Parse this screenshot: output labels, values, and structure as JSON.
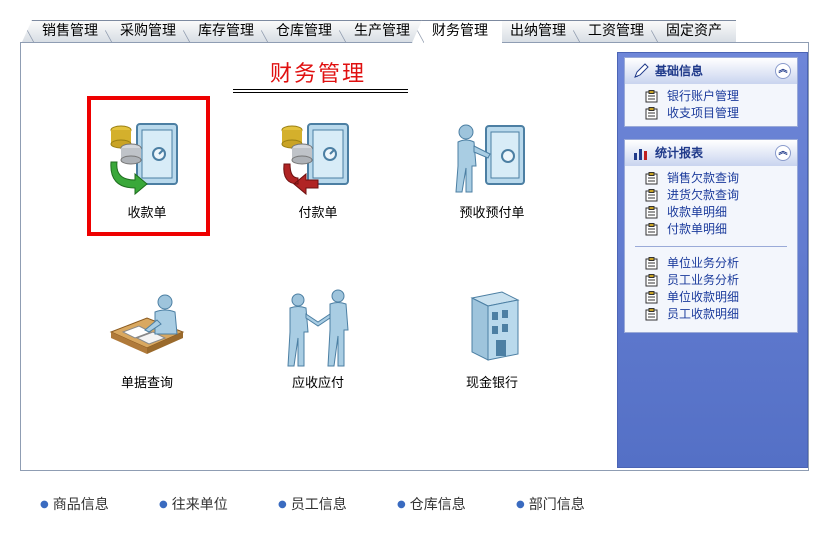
{
  "tabs": [
    {
      "label": "销售管理",
      "active": false
    },
    {
      "label": "采购管理",
      "active": false
    },
    {
      "label": "库存管理",
      "active": false
    },
    {
      "label": "仓库管理",
      "active": false
    },
    {
      "label": "生产管理",
      "active": false
    },
    {
      "label": "财务管理",
      "active": true
    },
    {
      "label": "出纳管理",
      "active": false
    },
    {
      "label": "工资管理",
      "active": false
    },
    {
      "label": "固定资产",
      "active": false
    }
  ],
  "main": {
    "title": "财务管理",
    "items": [
      {
        "label": "收款单",
        "icon": "safe-coins-receive-icon"
      },
      {
        "label": "付款单",
        "icon": "safe-coins-pay-icon"
      },
      {
        "label": "预收预付单",
        "icon": "person-safe-icon"
      },
      {
        "label": "单据查询",
        "icon": "person-desk-documents-icon"
      },
      {
        "label": "应收应付",
        "icon": "handshake-icon"
      },
      {
        "label": "现金银行",
        "icon": "bank-building-icon"
      }
    ]
  },
  "sidebar": {
    "basic": {
      "title": "基础信息",
      "items": [
        "银行账户管理",
        "收支项目管理"
      ]
    },
    "reports": {
      "title": "统计报表",
      "group1": [
        "销售欠款查询",
        "进货欠款查询",
        "收款单明细",
        "付款单明细"
      ],
      "group2": [
        "单位业务分析",
        "员工业务分析",
        "单位收款明细",
        "员工收款明细"
      ]
    }
  },
  "bottom_nav": [
    "商品信息",
    "往来单位",
    "员工信息",
    "仓库信息",
    "部门信息"
  ],
  "colors": {
    "title_red": "#e01010",
    "highlight_red": "#ee0000",
    "panel_blue": "#5470c6",
    "link_blue": "#1b3b9c"
  }
}
